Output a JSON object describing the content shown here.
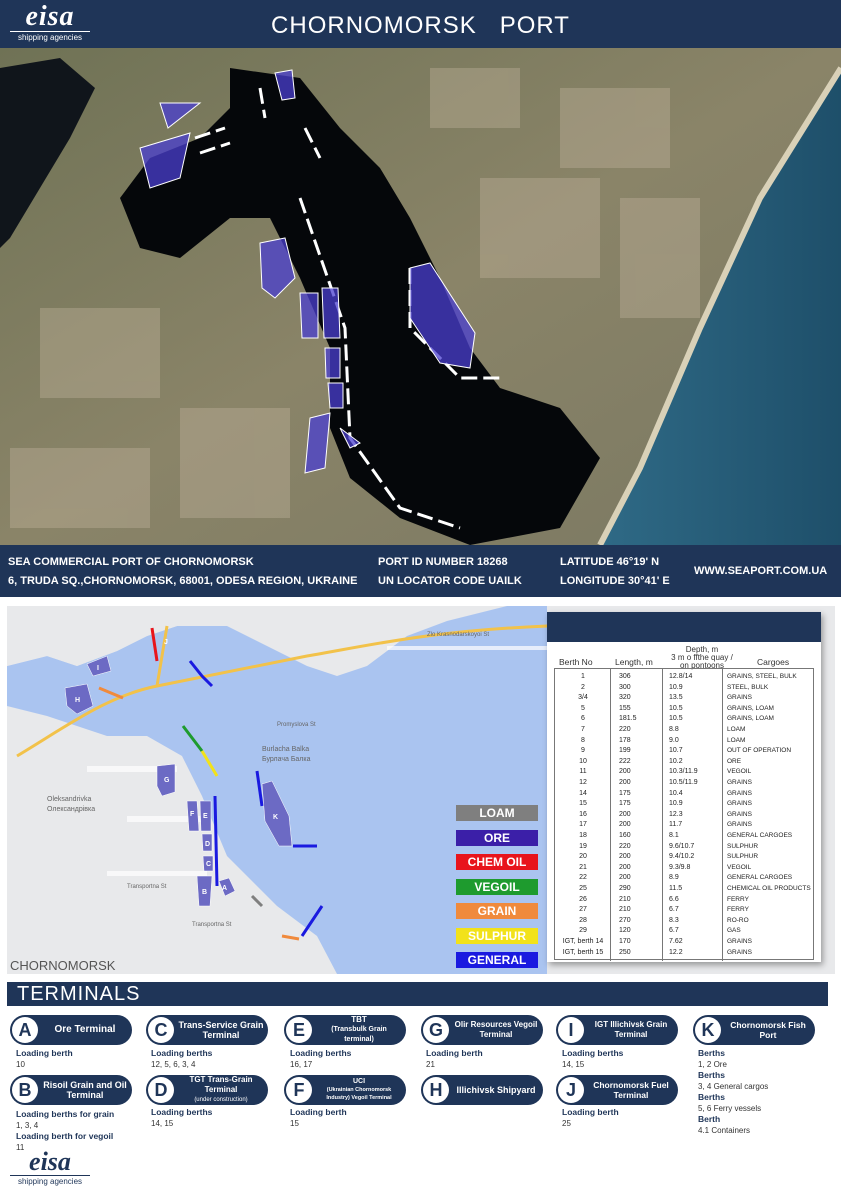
{
  "header": {
    "logo_word": "eisa",
    "logo_sub": "shipping agencies",
    "title": "CHORNOMORSK   PORT"
  },
  "info": {
    "port_name": "SEA COMMERCIAL PORT OF CHORNOMORSK",
    "address": "6, TRUDA SQ.,CHORNOMORSK, 68001, ODESA REGION, UKRAINE",
    "port_id": "PORT ID NUMBER 18268",
    "un_locator": "UN LOCATOR CODE UAILK",
    "latitude": "LATITUDE 46°19' N",
    "longitude": "LONGITUDE 30°41' E",
    "website": "WWW.SEAPORT.COM.UA"
  },
  "map": {
    "city_label": "CHORNOMORSK",
    "place_1": "Burlacha Balka",
    "place_2": "Бурлача Балка",
    "place_3": "Oleksandrivka",
    "place_4": "Олександрівка",
    "road_1": "Zlo Krasnodarskoyoi St",
    "road_2": "Transportna St",
    "road_3": "Promyslova St",
    "legend": [
      {
        "label": "LOAM",
        "color": "#7f7f7f"
      },
      {
        "label": "ORE",
        "color": "#3b1fa8"
      },
      {
        "label": "CHEM OIL",
        "color": "#e8141c"
      },
      {
        "label": "VEGOIL",
        "color": "#1e9b2e"
      },
      {
        "label": "GRAIN",
        "color": "#f08a3c"
      },
      {
        "label": "SULPHUR",
        "color": "#f2e21a"
      },
      {
        "label": "GENERAL",
        "color": "#1a1ae0"
      }
    ],
    "zones": [
      {
        "letter": "I"
      },
      {
        "letter": "H"
      },
      {
        "letter": "J"
      },
      {
        "letter": "G"
      },
      {
        "letter": "F"
      },
      {
        "letter": "E"
      },
      {
        "letter": "D"
      },
      {
        "letter": "C"
      },
      {
        "letter": "B"
      },
      {
        "letter": "A"
      },
      {
        "letter": "K"
      }
    ]
  },
  "berths": {
    "headers": {
      "berth_no": "Berth No",
      "length": "Length, m",
      "depth_1": "Depth, m",
      "depth_2": "3 m o ffthe quay /",
      "depth_3": "on pontoons",
      "cargoes": "Cargoes"
    },
    "rows": [
      {
        "no": "1",
        "len": "306",
        "depth": "12.8/14",
        "cargo": "GRAINS, STEEL, BULK"
      },
      {
        "no": "2",
        "len": "300",
        "depth": "10.9",
        "cargo": "STEEL, BULK"
      },
      {
        "no": "3/4",
        "len": "320",
        "depth": "13.5",
        "cargo": "GRAINS"
      },
      {
        "no": "5",
        "len": "155",
        "depth": "10.5",
        "cargo": "GRAINS, LOAM"
      },
      {
        "no": "6",
        "len": "181.5",
        "depth": "10.5",
        "cargo": "GRAINS, LOAM"
      },
      {
        "no": "7",
        "len": "220",
        "depth": "8.8",
        "cargo": "LOAM"
      },
      {
        "no": "8",
        "len": "178",
        "depth": "9.0",
        "cargo": "LOAM"
      },
      {
        "no": "9",
        "len": "199",
        "depth": "10.7",
        "cargo": "OUT OF OPERATION"
      },
      {
        "no": "10",
        "len": "222",
        "depth": "10.2",
        "cargo": "ORE"
      },
      {
        "no": "11",
        "len": "200",
        "depth": "10.3/11.9",
        "cargo": "VEGOIL"
      },
      {
        "no": "12",
        "len": "200",
        "depth": "10.5/11.9",
        "cargo": "GRAINS"
      },
      {
        "no": "14",
        "len": "175",
        "depth": "10.4",
        "cargo": "GRAINS"
      },
      {
        "no": "15",
        "len": "175",
        "depth": "10.9",
        "cargo": "GRAINS"
      },
      {
        "no": "16",
        "len": "200",
        "depth": "12.3",
        "cargo": "GRAINS"
      },
      {
        "no": "17",
        "len": "200",
        "depth": "11.7",
        "cargo": "GRAINS"
      },
      {
        "no": "18",
        "len": "160",
        "depth": "8.1",
        "cargo": "GENERAL CARGOES"
      },
      {
        "no": "19",
        "len": "220",
        "depth": "9.6/10.7",
        "cargo": "SULPHUR"
      },
      {
        "no": "20",
        "len": "200",
        "depth": "9.4/10.2",
        "cargo": "SULPHUR"
      },
      {
        "no": "21",
        "len": "200",
        "depth": "9.3/9.8",
        "cargo": "VEGOIL"
      },
      {
        "no": "22",
        "len": "200",
        "depth": "8.9",
        "cargo": "GENERAL CARGOES"
      },
      {
        "no": "25",
        "len": "290",
        "depth": "11.5",
        "cargo": "CHEMICAL OIL PRODUCTS"
      },
      {
        "no": "26",
        "len": "210",
        "depth": "6.6",
        "cargo": "FERRY"
      },
      {
        "no": "27",
        "len": "210",
        "depth": "6.7",
        "cargo": "FERRY"
      },
      {
        "no": "28",
        "len": "270",
        "depth": "8.3",
        "cargo": "RO-RO"
      },
      {
        "no": "29",
        "len": "120",
        "depth": "6.7",
        "cargo": "GAS"
      },
      {
        "no": "IGT, berth 14",
        "len": "170",
        "depth": "7.62",
        "cargo": "GRAINS"
      },
      {
        "no": "IGT, berth 15",
        "len": "250",
        "depth": "12.2",
        "cargo": "GRAINS"
      }
    ]
  },
  "terminals": {
    "title": "TERMINALS",
    "A": {
      "letter": "A",
      "name": "Ore Terminal",
      "label": "Loading berth",
      "value": "10"
    },
    "B": {
      "letter": "B",
      "name": "Risoil Grain and Oil Terminal",
      "label": "Loading berths for grain",
      "value": "1, 3, 4",
      "label2": "Loading berth for vegoil",
      "value2": "11"
    },
    "C": {
      "letter": "C",
      "name": "Trans-Service Grain Terminal",
      "label": "Loading berths",
      "value": "12, 5, 6, 3, 4"
    },
    "D": {
      "letter": "D",
      "name": "TGT Trans-Grain Terminal",
      "sub": "(under construction)",
      "label": "Loading berths",
      "value": "14, 15"
    },
    "E": {
      "letter": "E",
      "name": "TBT",
      "sub": "(Transbulk Grain terminal)",
      "label": "Loading berths",
      "value": "16, 17"
    },
    "F": {
      "letter": "F",
      "name": "UCI",
      "sub": "(Ukrainian Chornomorsk Industry) Vegoil Terminal",
      "label": "Loading berth",
      "value": "15"
    },
    "G": {
      "letter": "G",
      "name": "Olir Resources Vegoil Terminal",
      "label": "Loading berth",
      "value": "21"
    },
    "H": {
      "letter": "H",
      "name": "Illichivsk Shipyard"
    },
    "I": {
      "letter": "I",
      "name": "IGT Illichivsk Grain Terminal",
      "label": "Loading berths",
      "value": "14, 15"
    },
    "J": {
      "letter": "J",
      "name": "Chornomorsk Fuel Terminal",
      "label": "Loading berth",
      "value": "25"
    },
    "K": {
      "letter": "K",
      "name": "Chornomorsk Fish Port",
      "berths_label": "Berths",
      "berths_1": "1, 2 Ore",
      "berths_2": "3, 4 General cargos",
      "berths_3": "5, 6 Ferry vessels",
      "berth_label": "Berth",
      "berth_4": "4.1 Containers"
    }
  },
  "footer": {
    "logo_word": "eisa",
    "logo_sub": "shipping agencies"
  }
}
